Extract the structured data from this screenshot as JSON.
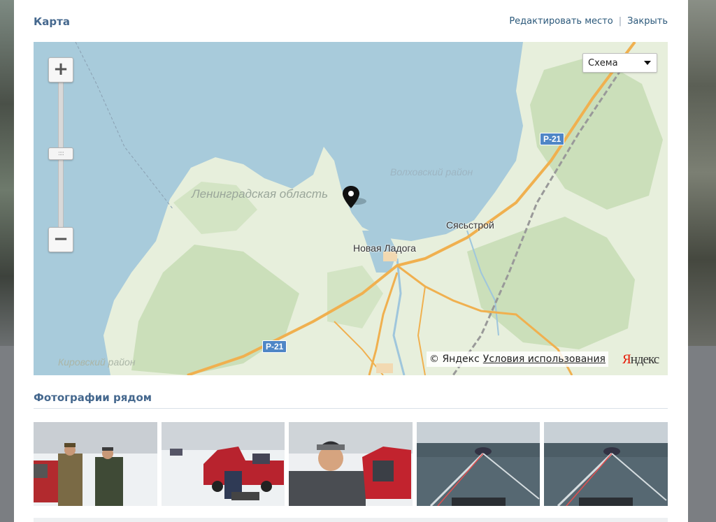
{
  "header": {
    "title": "Карта",
    "edit_place_link": "Редактировать место",
    "separator": "|",
    "close_link": "Закрыть"
  },
  "map": {
    "zoom_in_symbol": "+",
    "zoom_out_symbol": "−",
    "zoom_handle_grip": "::::",
    "zoom_level": 0.6,
    "map_type_select": "Схема",
    "labels": {
      "region": "Ленинградская область",
      "district_lake": "Волховский район",
      "district_kirov": "Кировский район",
      "town_novaya_ladoga": "Новая Ладога",
      "town_syasstroy": "Сясьстрой"
    },
    "road_badges": [
      "Р-21",
      "Р-21"
    ],
    "copyright": "© Яндекс",
    "terms_link": "Условия использования",
    "provider_logo": "Яндекс",
    "icons": {
      "marker": "map-pin-icon",
      "zoom_in": "plus-icon",
      "zoom_out": "minus-icon",
      "dropdown": "caret-down-icon"
    },
    "colors": {
      "water": "#a8cbdb",
      "land": "#e9f0df",
      "forest": "#c9deb9",
      "road": "#f0b04f",
      "road_badge": "#4f86c6"
    }
  },
  "nearby": {
    "title": "Фотографии рядом",
    "photos": [
      "photo-two-fishermen",
      "photo-red-cars-on-ice",
      "photo-man-in-hat",
      "photo-boat-wake",
      "photo-boat-wake-2"
    ]
  },
  "theme": {
    "link_color": "#2b587a",
    "title_color": "#45688e"
  }
}
